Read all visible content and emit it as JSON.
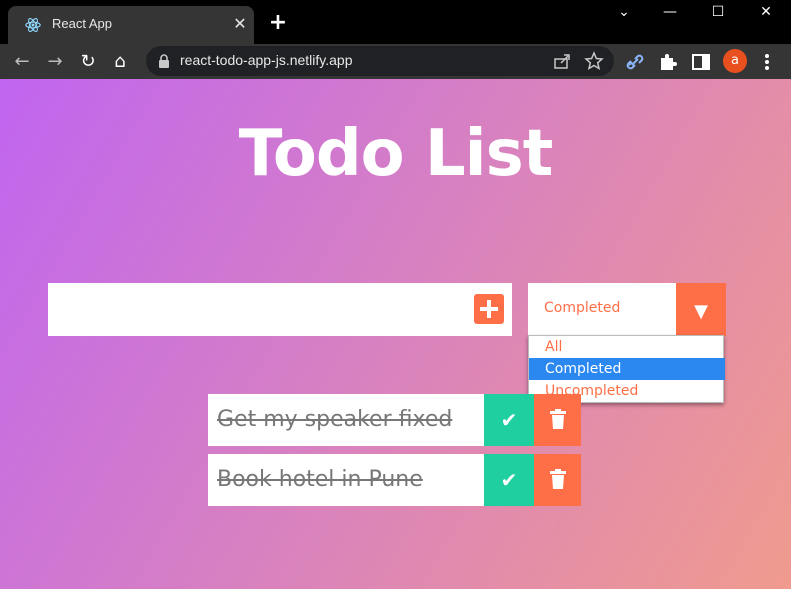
{
  "browser": {
    "tab_title": "React App",
    "tab_close": "✕",
    "new_tab": "+",
    "url": "react-todo-app-js.netlify.app",
    "avatar_letter": "a",
    "window_controls": {
      "dropdown": "⌄",
      "minimize": "—",
      "maximize": "☐",
      "close": "✕"
    },
    "nav": {
      "back": "←",
      "forward": "→",
      "reload": "↻",
      "home": "⌂"
    }
  },
  "app": {
    "title": "Todo List",
    "input": {
      "value": "",
      "placeholder": ""
    },
    "filter": {
      "selected": "Completed",
      "options": [
        "All",
        "Completed",
        "Uncompleted"
      ],
      "highlighted_index": 1
    },
    "todos": [
      {
        "text": "Get my speaker fixed",
        "completed": true
      },
      {
        "text": "Book hotel in Pune",
        "completed": true
      }
    ]
  },
  "colors": {
    "accent": "#ff6f47",
    "complete": "#1fcf9f",
    "selected_option": "#2b88f0"
  },
  "icons": {
    "check": "✔"
  }
}
